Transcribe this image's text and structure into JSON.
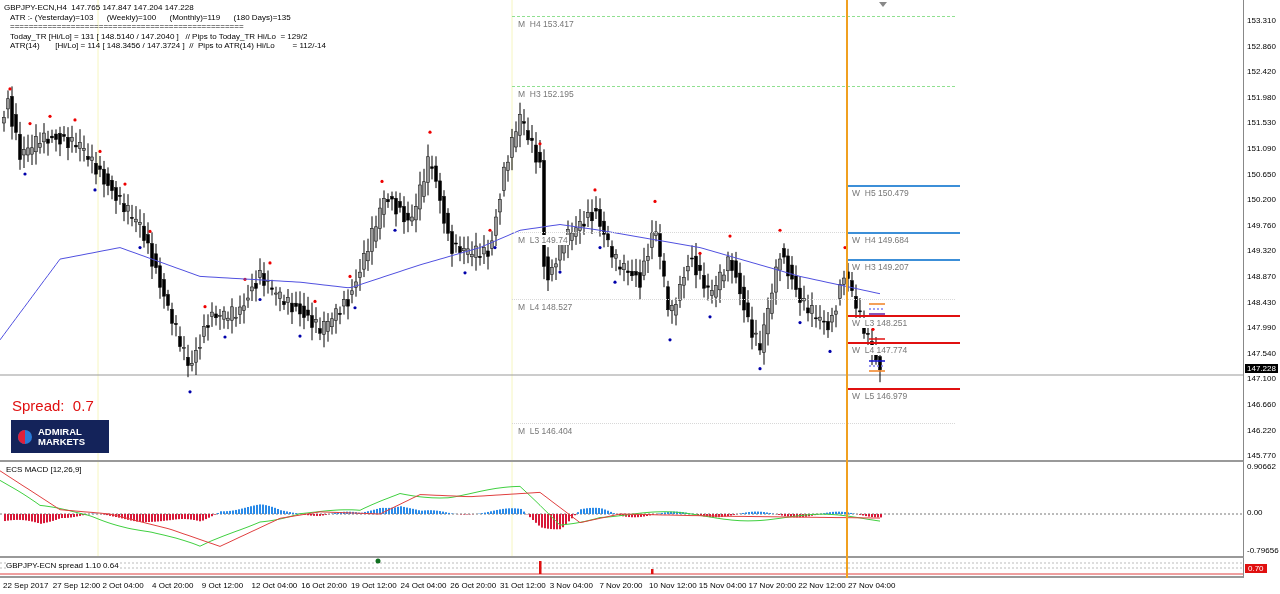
{
  "chart": {
    "title": "GBPJPY-ECN,H4  147.765 147.847 147.204 147.228",
    "info_lines": [
      "ATR :- (Yesterday)=103      (Weekly)=100      (Monthly)=119      (180 Days)=135",
      "==================================================",
      "Today_TR [Hi/Lo] = 131 [ 148.5140 / 147.2040 ]   // Pips to Today_TR Hi/Lo  = 129/2",
      "ATR(14)       [Hi/Lo] = 114 [ 148.3456 / 147.3724 ]  //  Pips to ATR(14) Hi/Lo        = 112/-14"
    ],
    "spread_label": "Spread:  0.7",
    "logo": {
      "line1": "ADMIRAL",
      "line2": "MARKETS"
    },
    "levels": [
      {
        "label": "M  H4 153.417",
        "color": "#90e090",
        "kind": "dashed"
      },
      {
        "label": "M  H3 152.195",
        "color": "#90e090",
        "kind": "dashed"
      },
      {
        "label": "M  L3 149.74",
        "color": "#d8d8d8",
        "kind": "dotted"
      },
      {
        "label": "M  L4 148.527",
        "color": "#d8d8d8",
        "kind": "dotted"
      },
      {
        "label": "M  L5 146.404",
        "color": "#d8d8d8",
        "kind": "dotted"
      },
      {
        "label": "W  H5 150.479",
        "color": "#3c8fd8",
        "kind": "solid"
      },
      {
        "label": "W  H4 149.684",
        "color": "#3c8fd8",
        "kind": "solid"
      },
      {
        "label": "W  H3 149.207",
        "color": "#3c8fd8",
        "kind": "solid"
      },
      {
        "label": "W  L3 148.251",
        "color": "#e01010",
        "kind": "solid"
      },
      {
        "label": "W  L4 147.774",
        "color": "#e01010",
        "kind": "solid"
      },
      {
        "label": "W  L5 146.979",
        "color": "#e01010",
        "kind": "solid"
      }
    ],
    "price_axis": [
      "153.310",
      "152.860",
      "152.420",
      "151.980",
      "151.530",
      "151.090",
      "150.650",
      "150.200",
      "149.760",
      "149.320",
      "148.870",
      "148.430",
      "147.990",
      "147.540",
      "147.100",
      "146.660",
      "146.220",
      "145.770"
    ],
    "current_price": "147.228"
  },
  "macd": {
    "title": "ECS MACD [12,26,9]",
    "axis": [
      "0.90662",
      "0.00",
      "-0.79656"
    ]
  },
  "spread": {
    "title": "GBPJPY-ECN spread 1.10 0.64",
    "current": "0.70"
  },
  "time_axis": [
    "22 Sep 2017",
    "27 Sep 12:00",
    "2 Oct 04:00",
    "4 Oct 20:00",
    "9 Oct 12:00",
    "12 Oct 04:00",
    "16 Oct 20:00",
    "19 Oct 12:00",
    "24 Oct 04:00",
    "26 Oct 20:00",
    "31 Oct 12:00",
    "3 Nov 04:00",
    "7 Nov 20:00",
    "10 Nov 12:00",
    "15 Nov 04:00",
    "17 Nov 20:00",
    "22 Nov 12:00",
    "27 Nov 04:00"
  ]
}
